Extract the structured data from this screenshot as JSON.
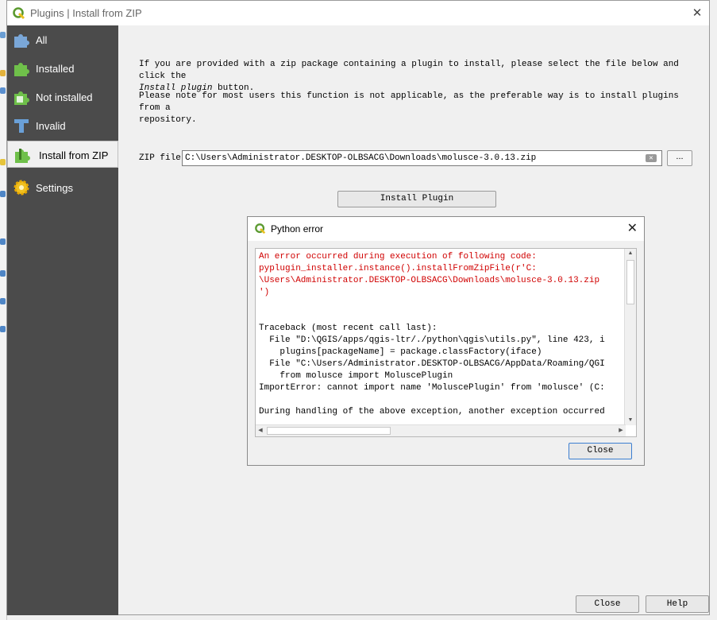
{
  "window": {
    "title": "Plugins | Install from ZIP"
  },
  "sidebar": {
    "items": [
      {
        "label": "All",
        "icon": "puzzle-all-icon"
      },
      {
        "label": "Installed",
        "icon": "puzzle-installed-icon"
      },
      {
        "label": "Not installed",
        "icon": "puzzle-not-installed-icon"
      },
      {
        "label": "Invalid",
        "icon": "puzzle-invalid-icon"
      },
      {
        "label": "Install from ZIP",
        "icon": "puzzle-zip-icon",
        "selected": true
      },
      {
        "label": "Settings",
        "icon": "gear-icon"
      }
    ]
  },
  "main": {
    "intro_1": "If you are provided with a zip package containing a plugin to install, please select the file below and click the",
    "intro_2_em": "Install plugin",
    "intro_2_rest": " button.",
    "note_1": "Please note for most users this function is not applicable, as the preferable way is to install plugins from a",
    "note_2": "repository.",
    "zip_label": "ZIP file",
    "zip_value": "C:\\Users\\Administrator.DESKTOP-OLBSACG\\Downloads\\molusce-3.0.13.zip",
    "browse_label": "...",
    "install_button": "Install Plugin",
    "close_button": "Close",
    "help_button": "Help"
  },
  "error_dialog": {
    "title": "Python error",
    "close_button": "Close",
    "red_text": "An error occurred during execution of following code:\npyplugin_installer.instance().installFromZipFile(r'C:\n\\Users\\Administrator.DESKTOP-OLBSACG\\Downloads\\molusce-3.0.13.zip\n')",
    "trace_text": "Traceback (most recent call last):\n  File \"D:\\QGIS/apps/qgis-ltr/./python\\qgis\\utils.py\", line 423, i\n    plugins[packageName] = package.classFactory(iface)\n  File \"C:\\Users/Administrator.DESKTOP-OLBSACG/AppData/Roaming/QGI\n    from molusce import MoluscePlugin\nImportError: cannot import name 'MoluscePlugin' from 'molusce' (C:\n\nDuring handling of the above exception, another exception occurred"
  },
  "colors": {
    "sidebar_bg": "#4b4b4b",
    "error_text": "#d00000",
    "focus_border": "#3c7fd1"
  }
}
